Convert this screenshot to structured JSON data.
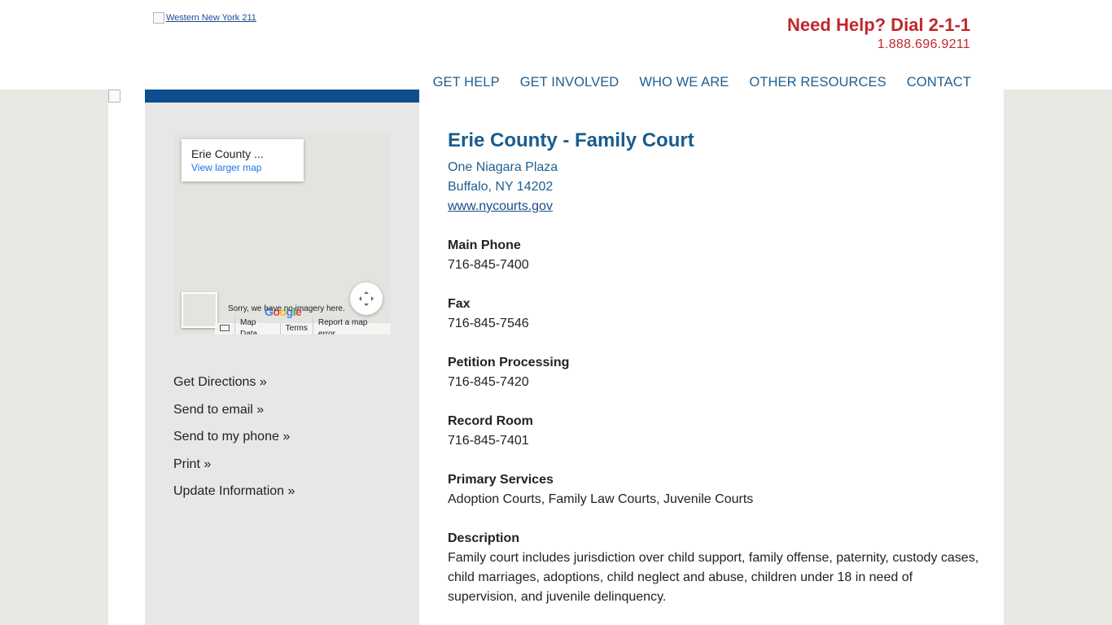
{
  "header": {
    "logo_alt": "Western New York 211",
    "help_title": "Need Help? Dial 2-1-1",
    "help_phone": "1.888.696.9211",
    "nav": [
      "GET HELP",
      "GET INVOLVED",
      "WHO WE ARE",
      "OTHER RESOURCES",
      "CONTACT"
    ]
  },
  "map": {
    "place_name": "Erie County ...",
    "view_larger": "View larger map",
    "sorry_text": "Sorry, we have no imagery here.",
    "google_letters": [
      "G",
      "o",
      "o",
      "g",
      "l",
      "e"
    ],
    "footer": [
      "Map Data",
      "Terms",
      "Report a map error"
    ]
  },
  "sidebar": {
    "links": [
      "Get Directions »",
      "Send to email »",
      "Send to my phone »",
      "Print »",
      "Update Information »"
    ]
  },
  "listing": {
    "title": "Erie County - Family Court",
    "address_line1": "One Niagara Plaza",
    "address_line2": "Buffalo, NY 14202",
    "website": "www.nycourts.gov",
    "fields": [
      {
        "label": "Main Phone",
        "value": "716-845-7400"
      },
      {
        "label": "Fax",
        "value": "716-845-7546"
      },
      {
        "label": "Petition Processing",
        "value": "716-845-7420"
      },
      {
        "label": "Record Room",
        "value": "716-845-7401"
      },
      {
        "label": "Primary Services",
        "value": "Adoption Courts, Family Law Courts, Juvenile Courts"
      },
      {
        "label": "Description",
        "value": "Family court includes jurisdiction over child support, family offense, paternity, custody cases, child marriages, adoptions, child neglect and abuse, children under 18 in need of supervision, and juvenile delinquency."
      }
    ]
  },
  "colors": {
    "nav": "#1f5f91",
    "help": "#c0272d",
    "sidebar_bar": "#0d4e8f",
    "title": "#1a5c8e"
  }
}
